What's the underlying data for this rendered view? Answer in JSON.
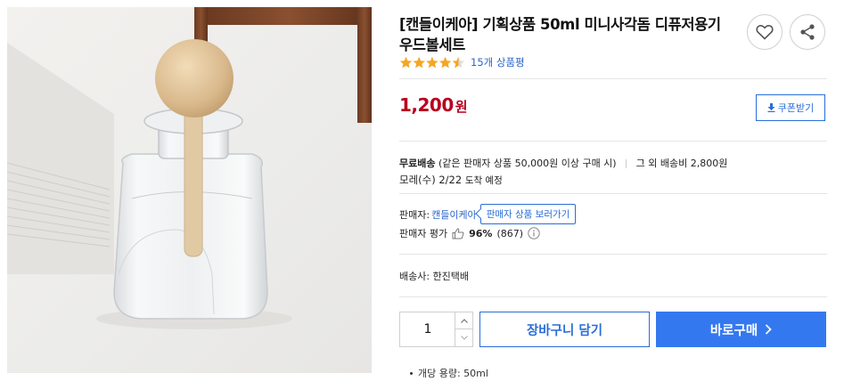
{
  "product": {
    "title": "[캔들이케아] 기획상품 50ml 미니사각돔 디퓨저용기 우드볼세트",
    "rating": 4.5,
    "review_link": "15개 상품평"
  },
  "price": {
    "amount": "1,200",
    "unit": "원"
  },
  "coupon": {
    "label": "쿠폰받기"
  },
  "shipping": {
    "free_label": "무료배송",
    "condition": "(같은 판매자 상품 50,000원 이상 구매 시)",
    "other_fee": "그 외 배송비 2,800원",
    "arrival_date": "모레(수) 2/22",
    "arrival_suffix": "도착 예정"
  },
  "seller": {
    "label": "판매자:",
    "name": "캔들이케아",
    "view_button": "판매자 상품 보러가기",
    "eval_label": "판매자 평가",
    "eval_percent": "96%",
    "eval_count": "(867)"
  },
  "courier": {
    "text": "배송사: 한진택배"
  },
  "purchase": {
    "quantity": "1",
    "cart_label": "장바구니 담기",
    "buy_label": "바로구매"
  },
  "specs": [
    "개당 용량: 50ml"
  ],
  "colors": {
    "accent": "#2a6ed8",
    "buy": "#3478f0",
    "price": "#b8001f",
    "star": "#f5a623"
  },
  "icons": [
    "heart-icon",
    "share-icon",
    "star-icon",
    "download-icon",
    "thumbs-up-icon",
    "info-icon",
    "chevron-up-icon",
    "chevron-down-icon",
    "chevron-right-icon"
  ]
}
